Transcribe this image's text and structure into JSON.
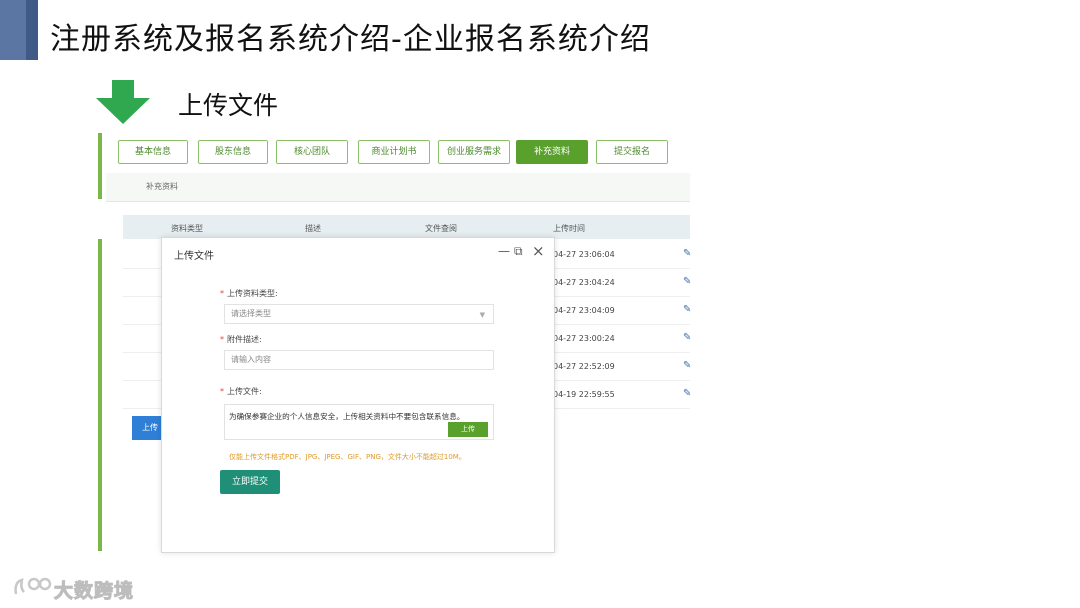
{
  "slide": {
    "title": "注册系统及报名系统介绍-企业报名系统介绍",
    "section_title": "上传文件"
  },
  "tabs": [
    {
      "label": "基本信息",
      "active": false
    },
    {
      "label": "股东信息",
      "active": false
    },
    {
      "label": "核心团队",
      "active": false
    },
    {
      "label": "商业计划书",
      "active": false
    },
    {
      "label": "创业服务需求",
      "active": false
    },
    {
      "label": "补充资料",
      "active": true
    },
    {
      "label": "提交报名",
      "active": false
    }
  ],
  "subtab": {
    "label": "补充资料"
  },
  "table": {
    "headers": [
      "资料类型",
      "描述",
      "文件查阅",
      "上传时间"
    ],
    "rows": [
      {
        "time": "04-27 23:06:04"
      },
      {
        "time": "04-27 23:04:24"
      },
      {
        "time": "04-27 23:04:09"
      },
      {
        "time": "04-27 23:00:24"
      },
      {
        "time": "04-27 22:52:09"
      },
      {
        "time": "04-19 22:59:55"
      }
    ],
    "edit_icon_glyph": "✎",
    "add_button_label": "上传"
  },
  "modal": {
    "title": "上传文件",
    "minimize_glyph": "—",
    "maximize_glyph": "⧉",
    "close_glyph": "×",
    "type_label": "上传资料类型:",
    "type_placeholder": "请选择类型",
    "desc_label": "附件描述:",
    "desc_placeholder": "请输入内容",
    "file_label": "上传文件:",
    "upload_notice": "为确保参赛企业的个人信息安全，上传相关资料中不要包含联系信息。",
    "upload_button": "上传",
    "format_hint": "仅能上传文件格式PDF、JPG、JPEG、GIF、PNG，文件大小不能超过10M。",
    "submit_button": "立即提交",
    "required_mark": "*"
  },
  "watermark": {
    "text": "大数跨境"
  },
  "colors": {
    "accent_navy": "#3f5a86",
    "green_primary": "#5aa02c",
    "green_arrow": "#2fa84f",
    "teal_submit": "#1f9077",
    "hint_orange": "#e09a2a",
    "blue_button": "#2f7fd6"
  }
}
